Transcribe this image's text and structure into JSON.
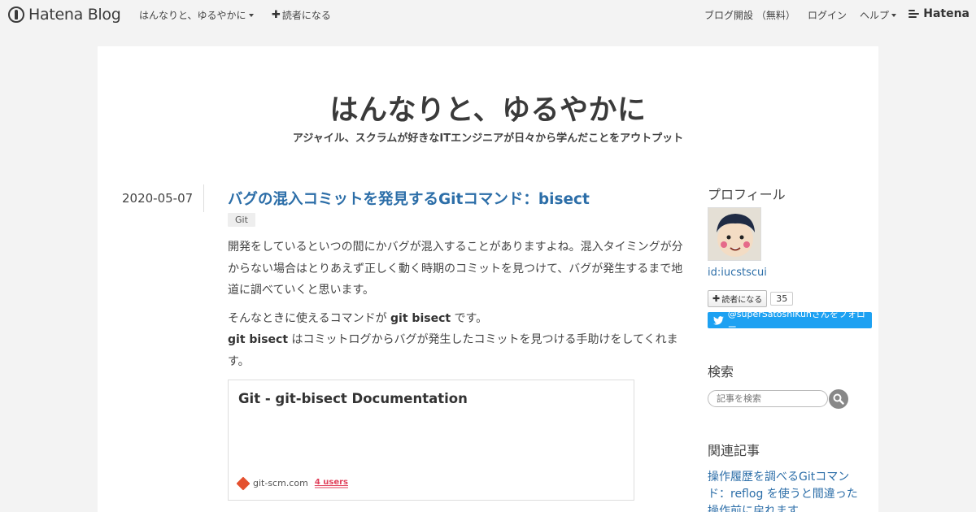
{
  "topbar": {
    "logo_text": "Hatena Blog",
    "blog_menu": "はんなりと、ゆるやかに",
    "subscribe": "読者になる",
    "create_blog": "ブログ開設 （無料）",
    "login": "ログイン",
    "help": "ヘルプ",
    "brand": "Hatena"
  },
  "blog": {
    "title": "はんなりと、ゆるやかに",
    "description": "アジャイル、スクラムが好きなITエンジニアが日々から学んだことをアウトプット"
  },
  "entry": {
    "date": "2020-05-07",
    "title": "バグの混入コミットを発見するGitコマンド：bisect",
    "category": "Git",
    "para1": "開発をしているといつの間にかバグが混入することがありますよね。混入タイミングが分からない場合はとりあえず正しく動く時期のコミットを見つけて、バグが発生するまで地道に調べていくと思います。",
    "para2_pre": "そんなときに使えるコマンドが ",
    "para2_bold": "git bisect",
    "para2_post": " です。",
    "para3_bold": "git bisect",
    "para3_post": " はコミットログからバグが発生したコミットを見つける手助けをしてくれます。",
    "card": {
      "title": "Git - git-bisect Documentation",
      "domain": "git-scm.com",
      "users": "4 users"
    }
  },
  "sidebar": {
    "profile_heading": "プロフィール",
    "profile_id": "id:iucstscui",
    "subscribe_label": "読者になる",
    "subscriber_count": "35",
    "twitter_follow": "@superSatoshiKunさんをフォロー",
    "search_heading": "検索",
    "search_placeholder": "記事を検索",
    "related_heading": "関連記事",
    "related_link": "操作履歴を調べるGitコマンド：reflog を使うと間違った操作前に戻れます"
  }
}
